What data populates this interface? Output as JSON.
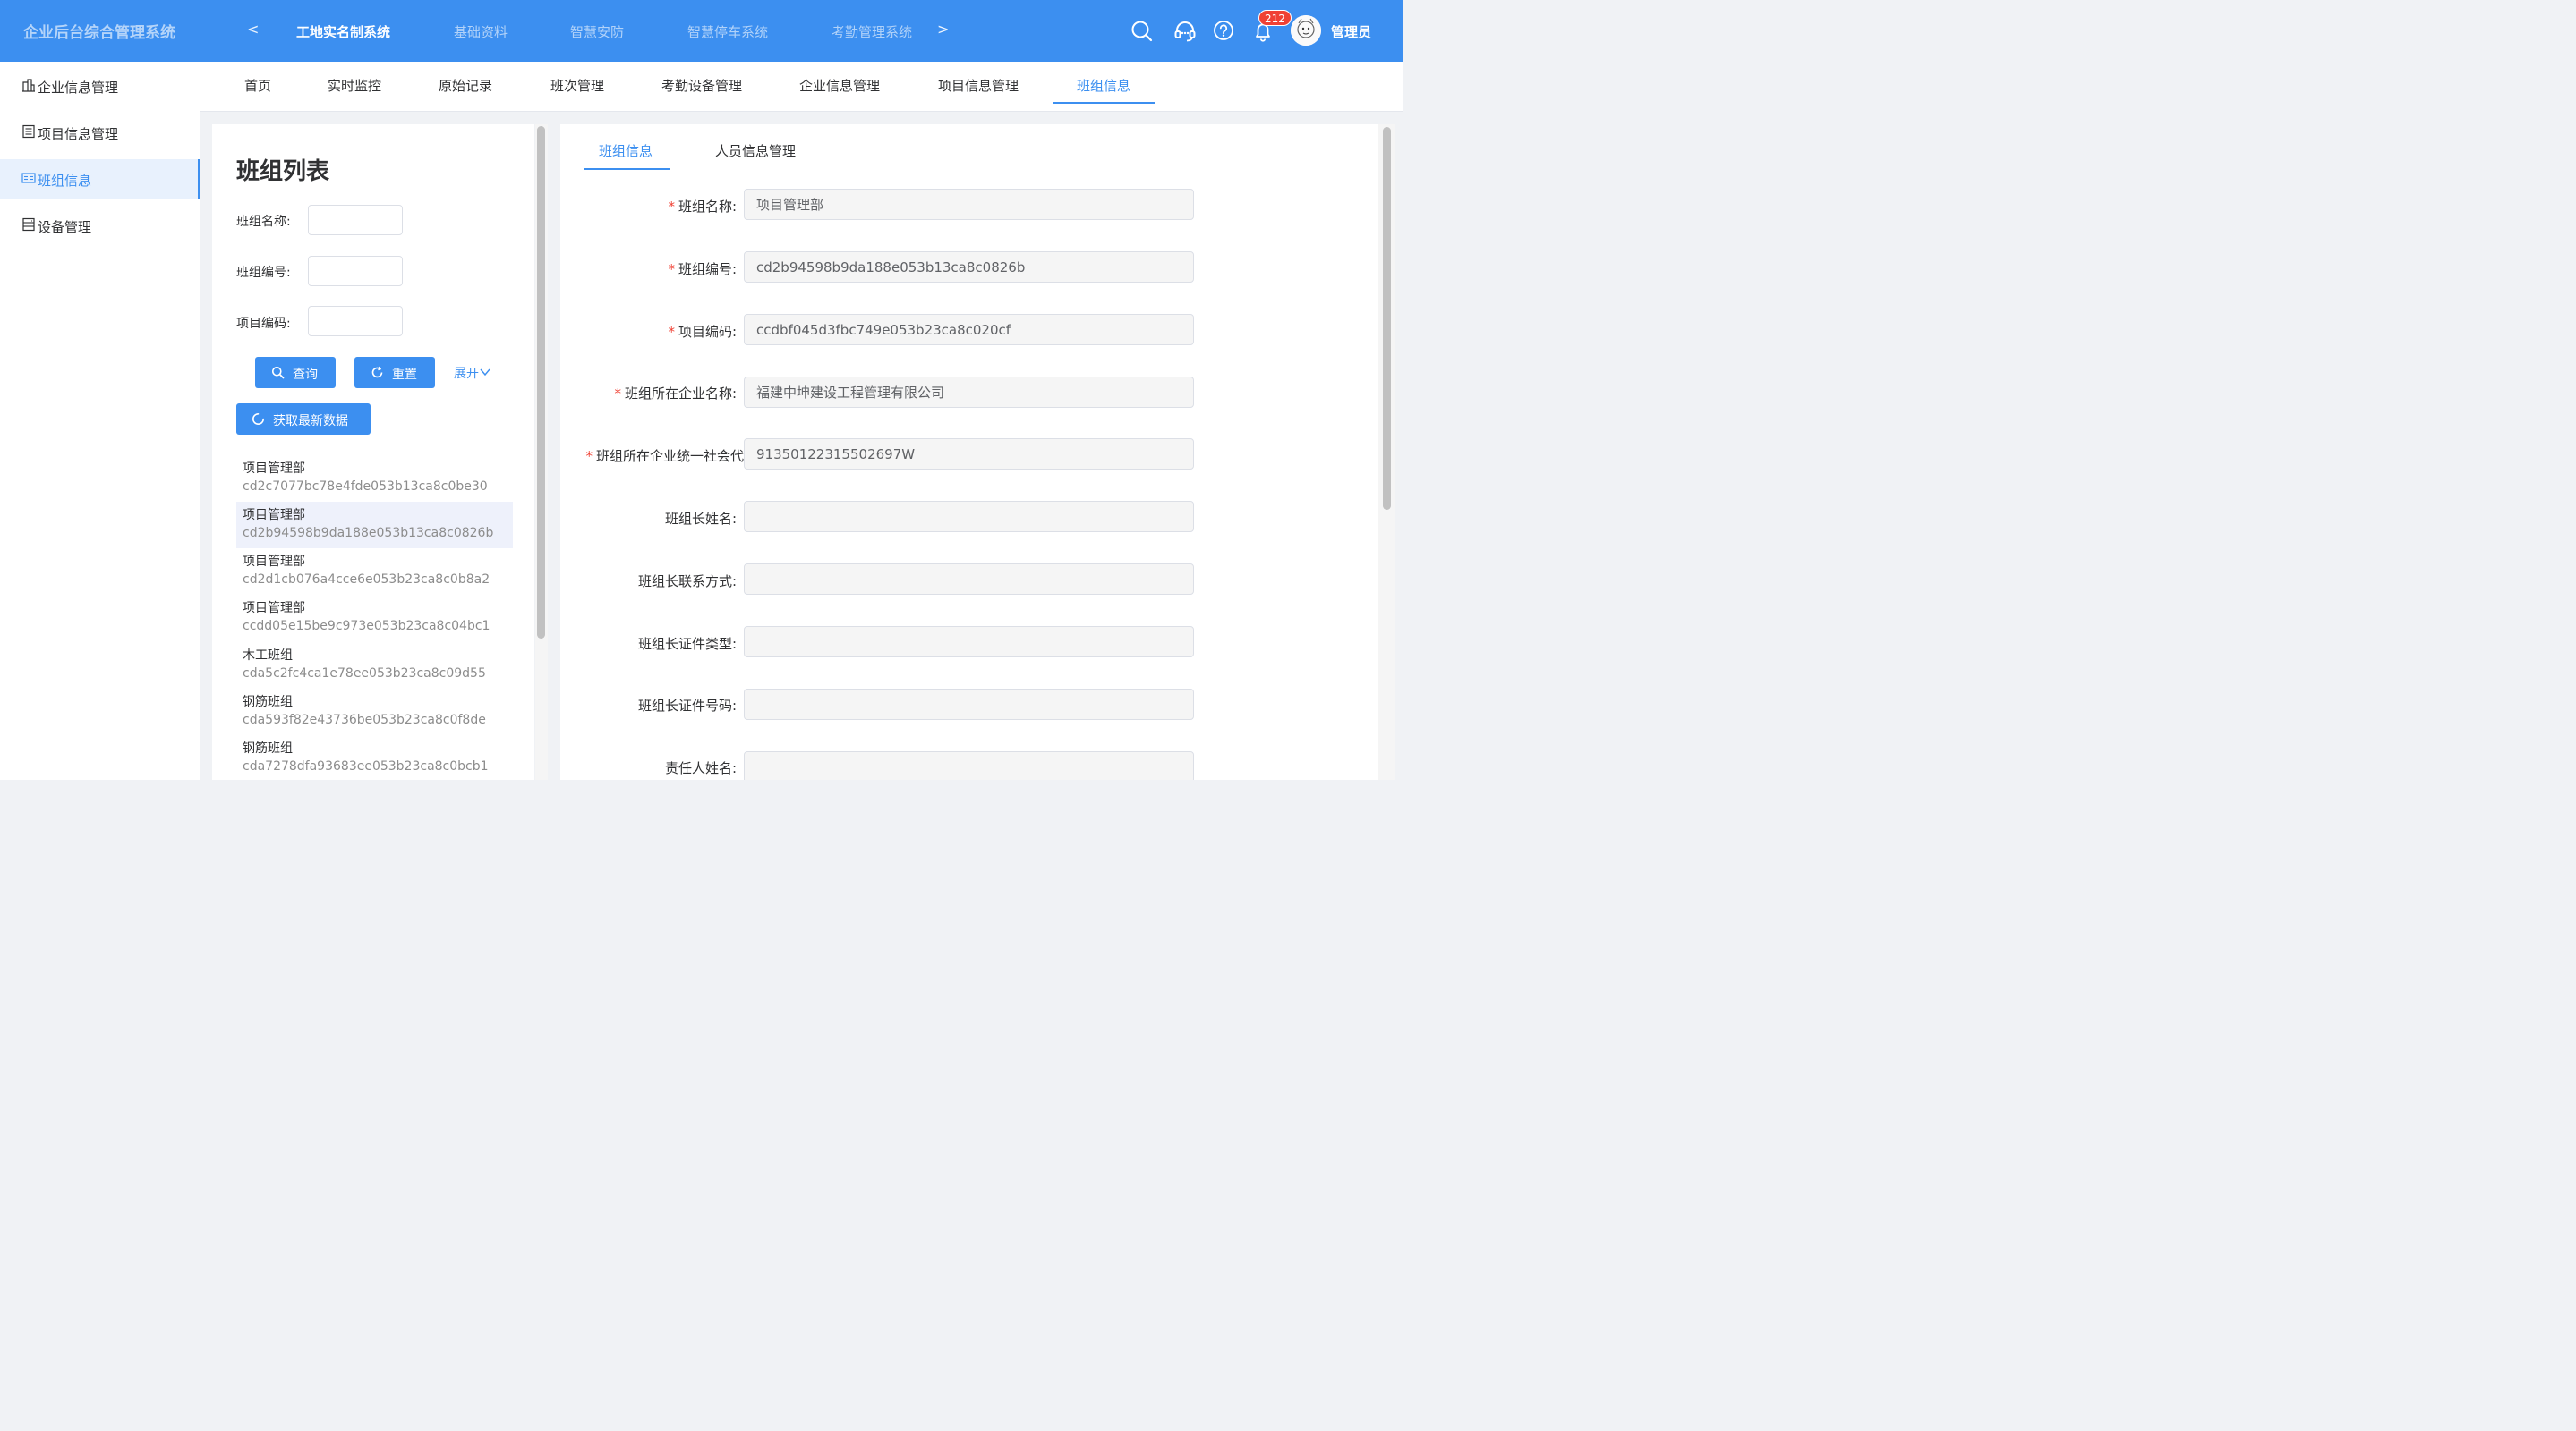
{
  "header": {
    "app_title": "企业后台综合管理系统",
    "prev_arrow": "<",
    "next_arrow": ">",
    "systems": [
      {
        "label": "工地实名制系统",
        "active": true
      },
      {
        "label": "基础资料",
        "active": false
      },
      {
        "label": "智慧安防",
        "active": false
      },
      {
        "label": "智慧停车系统",
        "active": false
      },
      {
        "label": "考勤管理系统",
        "active": false
      }
    ],
    "icons": [
      "search-icon",
      "headset-icon",
      "help-icon",
      "bell-icon"
    ],
    "notification_count": "212",
    "username": "管理员"
  },
  "sidebar": {
    "items": [
      {
        "label": "企业信息管理",
        "icon": "building-icon",
        "active": false
      },
      {
        "label": "项目信息管理",
        "icon": "document-icon",
        "active": false
      },
      {
        "label": "班组信息",
        "icon": "team-card-icon",
        "active": true
      },
      {
        "label": "设备管理",
        "icon": "device-icon",
        "active": false
      }
    ]
  },
  "page_tabs": [
    {
      "label": "首页"
    },
    {
      "label": "实时监控"
    },
    {
      "label": "原始记录"
    },
    {
      "label": "班次管理"
    },
    {
      "label": "考勤设备管理"
    },
    {
      "label": "企业信息管理"
    },
    {
      "label": "项目信息管理"
    },
    {
      "label": "班组信息",
      "active": true
    }
  ],
  "left_panel": {
    "title": "班组列表",
    "filters": [
      {
        "label": "班组名称:",
        "value": ""
      },
      {
        "label": "班组编号:",
        "value": ""
      },
      {
        "label": "项目编码:",
        "value": ""
      }
    ],
    "query_label": "查询",
    "reset_label": "重置",
    "expand_label": "展开",
    "refresh_label": "获取最新数据",
    "groups": [
      {
        "name": "项目管理部",
        "code": "cd2c7077bc78e4fde053b13ca8c0be30",
        "selected": false
      },
      {
        "name": "项目管理部",
        "code": "cd2b94598b9da188e053b13ca8c0826b",
        "selected": true
      },
      {
        "name": "项目管理部",
        "code": "cd2d1cb076a4cce6e053b23ca8c0b8a2",
        "selected": false
      },
      {
        "name": "项目管理部",
        "code": "ccdd05e15be9c973e053b23ca8c04bc1",
        "selected": false
      },
      {
        "name": "木工班组",
        "code": "cda5c2fc4ca1e78ee053b23ca8c09d55",
        "selected": false
      },
      {
        "name": "钢筋班组",
        "code": "cda593f82e43736be053b23ca8c0f8de",
        "selected": false
      },
      {
        "name": "钢筋班组",
        "code": "cda7278dfa93683ee053b23ca8c0bcb1",
        "selected": false
      }
    ]
  },
  "right_panel": {
    "tabs": [
      {
        "label": "班组信息",
        "active": true
      },
      {
        "label": "人员信息管理",
        "active": false
      }
    ],
    "fields": [
      {
        "label": "班组名称:",
        "required": true,
        "value": "项目管理部"
      },
      {
        "label": "班组编号:",
        "required": true,
        "value": "cd2b94598b9da188e053b13ca8c0826b"
      },
      {
        "label": "项目编码:",
        "required": true,
        "value": "ccdbf045d3fbc749e053b23ca8c020cf"
      },
      {
        "label": "班组所在企业名称:",
        "required": true,
        "value": "福建中坤建设工程管理有限公司"
      },
      {
        "label": "班组所在企业统一社会代",
        "required": true,
        "value": "91350122315502697W"
      },
      {
        "label": "班组长姓名:",
        "required": false,
        "value": ""
      },
      {
        "label": "班组长联系方式:",
        "required": false,
        "value": ""
      },
      {
        "label": "班组长证件类型:",
        "required": false,
        "value": ""
      },
      {
        "label": "班组长证件号码:",
        "required": false,
        "value": ""
      },
      {
        "label": "责任人姓名:",
        "required": false,
        "value": ""
      }
    ]
  },
  "colors": {
    "primary": "#3c8ff0",
    "required": "#f04134",
    "badge": "#f04134"
  }
}
